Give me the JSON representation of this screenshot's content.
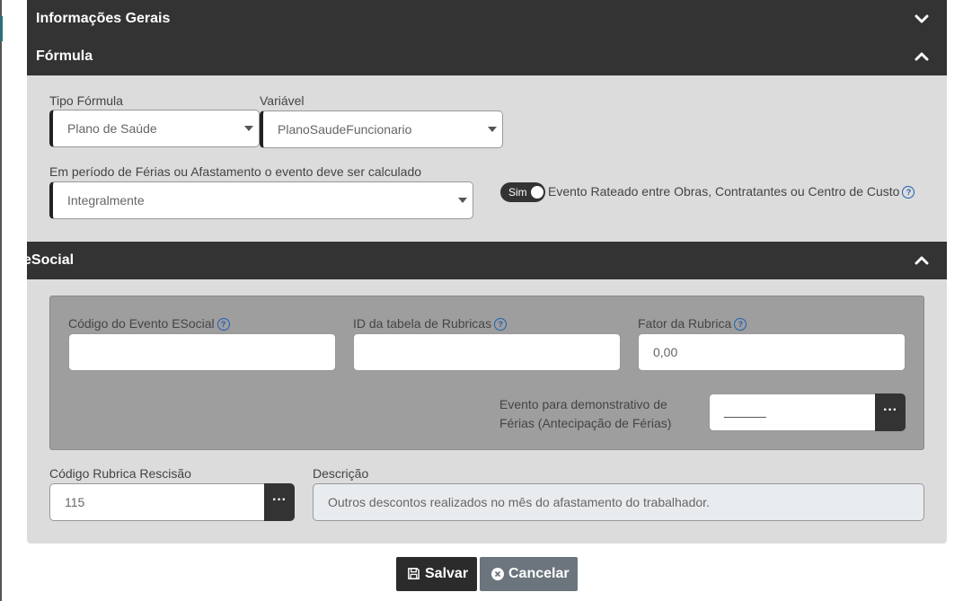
{
  "sections": {
    "gerais": {
      "title": "Informações Gerais"
    },
    "formula": {
      "title": "Fórmula"
    },
    "esocial": {
      "title": "eSocial"
    }
  },
  "formula": {
    "tipo_label": "Tipo Fórmula",
    "tipo_value": "Plano de Saúde",
    "variavel_label": "Variável",
    "variavel_value": "PlanoSaudeFuncionario",
    "periodo_label": "Em período de Férias ou Afastamento o evento deve ser calculado",
    "periodo_value": "Integralmente",
    "toggle_label": "Sim",
    "rateado_label": "Evento Rateado entre Obras, Contratantes ou Centro de Custo"
  },
  "esocial": {
    "codigo_label": "Código do Evento ESocial",
    "codigo_value": "",
    "id_label": "ID da tabela de Rubricas",
    "id_value": "",
    "fator_label": "Fator da Rubrica",
    "fator_placeholder": "0,00",
    "demo_label_1": "Evento para demonstrativo de",
    "demo_label_2": "Férias (Antecipação de Férias)",
    "demo_value": "______"
  },
  "rescisao": {
    "label": "Código Rubrica Rescisão",
    "value": "115",
    "descricao_label": "Descrição",
    "descricao_value": "Outros descontos realizados no mês do afastamento do trabalhador."
  },
  "buttons": {
    "lookup": "···",
    "save": "Salvar",
    "cancel": "Cancelar"
  },
  "colors": {
    "header_bg": "#333333",
    "panel_bg": "#dcdcdc",
    "inner_bg": "#9e9e9e",
    "cancel_bg": "#6c757d",
    "help_blue": "#1e5fb4"
  }
}
